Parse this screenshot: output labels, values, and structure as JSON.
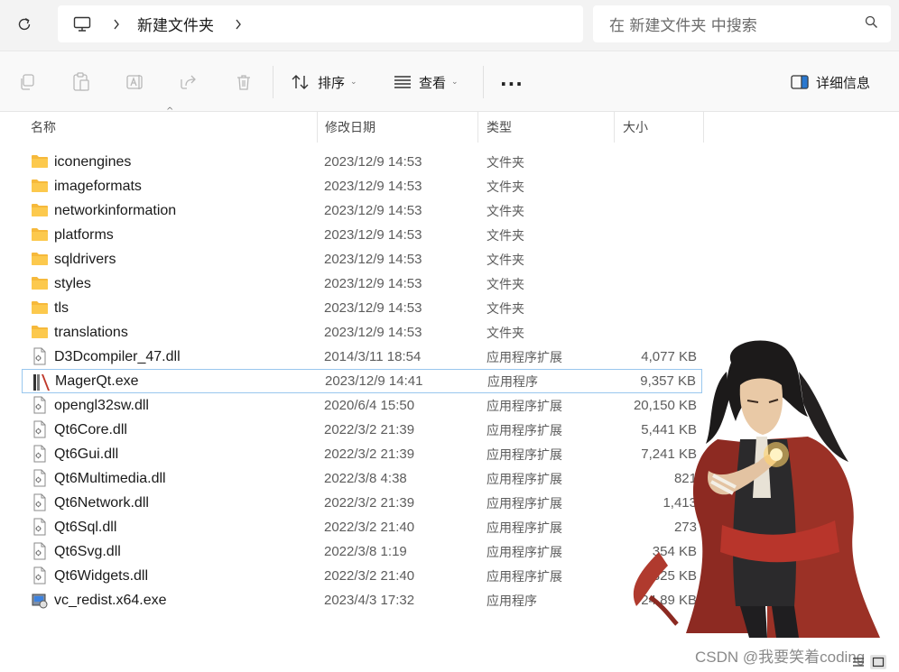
{
  "address": {
    "breadcrumb": "新建文件夹",
    "search_placeholder": "在 新建文件夹 中搜索"
  },
  "toolbar": {
    "sort_label": "排序",
    "view_label": "查看",
    "more_label": "···",
    "details_label": "详细信息"
  },
  "columns": {
    "name": "名称",
    "date": "修改日期",
    "type": "类型",
    "size": "大小"
  },
  "files": [
    {
      "name": "iconengines",
      "date": "2023/12/9 14:53",
      "type": "文件夹",
      "size": "",
      "icon": "folder-icon"
    },
    {
      "name": "imageformats",
      "date": "2023/12/9 14:53",
      "type": "文件夹",
      "size": "",
      "icon": "folder-icon"
    },
    {
      "name": "networkinformation",
      "date": "2023/12/9 14:53",
      "type": "文件夹",
      "size": "",
      "icon": "folder-icon"
    },
    {
      "name": "platforms",
      "date": "2023/12/9 14:53",
      "type": "文件夹",
      "size": "",
      "icon": "folder-icon"
    },
    {
      "name": "sqldrivers",
      "date": "2023/12/9 14:53",
      "type": "文件夹",
      "size": "",
      "icon": "folder-icon"
    },
    {
      "name": "styles",
      "date": "2023/12/9 14:53",
      "type": "文件夹",
      "size": "",
      "icon": "folder-icon"
    },
    {
      "name": "tls",
      "date": "2023/12/9 14:53",
      "type": "文件夹",
      "size": "",
      "icon": "folder-icon"
    },
    {
      "name": "translations",
      "date": "2023/12/9 14:53",
      "type": "文件夹",
      "size": "",
      "icon": "folder-icon"
    },
    {
      "name": "D3Dcompiler_47.dll",
      "date": "2014/3/11 18:54",
      "type": "应用程序扩展",
      "size": "4,077 KB",
      "icon": "dll-file-icon"
    },
    {
      "name": "MagerQt.exe",
      "date": "2023/12/9 14:41",
      "type": "应用程序",
      "size": "9,357 KB",
      "icon": "exe-app-icon"
    },
    {
      "name": "opengl32sw.dll",
      "date": "2020/6/4 15:50",
      "type": "应用程序扩展",
      "size": "20,150 KB",
      "icon": "dll-file-icon"
    },
    {
      "name": "Qt6Core.dll",
      "date": "2022/3/2 21:39",
      "type": "应用程序扩展",
      "size": "5,441 KB",
      "icon": "dll-file-icon"
    },
    {
      "name": "Qt6Gui.dll",
      "date": "2022/3/2 21:39",
      "type": "应用程序扩展",
      "size": "7,241 KB",
      "icon": "dll-file-icon"
    },
    {
      "name": "Qt6Multimedia.dll",
      "date": "2022/3/8 4:38",
      "type": "应用程序扩展",
      "size": "821",
      "icon": "dll-file-icon"
    },
    {
      "name": "Qt6Network.dll",
      "date": "2022/3/2 21:39",
      "type": "应用程序扩展",
      "size": "1,413",
      "icon": "dll-file-icon"
    },
    {
      "name": "Qt6Sql.dll",
      "date": "2022/3/2 21:40",
      "type": "应用程序扩展",
      "size": "273",
      "icon": "dll-file-icon"
    },
    {
      "name": "Qt6Svg.dll",
      "date": "2022/3/8 1:19",
      "type": "应用程序扩展",
      "size": "354 KB",
      "icon": "dll-file-icon"
    },
    {
      "name": "Qt6Widgets.dll",
      "date": "2022/3/2 21:40",
      "type": "应用程序扩展",
      "size": "5,825 KB",
      "icon": "dll-file-icon"
    },
    {
      "name": "vc_redist.x64.exe",
      "date": "2023/4/3 17:32",
      "type": "应用程序",
      "size": "24,89 KB",
      "icon": "installer-icon"
    }
  ],
  "selected_index": 9,
  "watermark": "CSDN @我要笑着coding"
}
